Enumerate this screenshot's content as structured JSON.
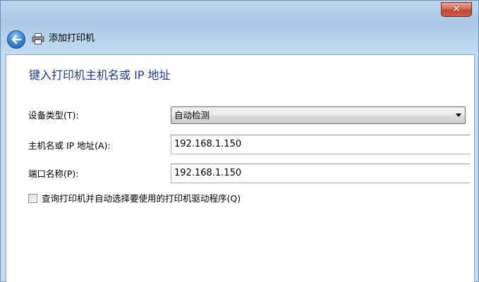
{
  "window": {
    "title": "添加打印机",
    "close_label": "✕"
  },
  "main": {
    "heading": "键入打印机主机名或 IP 地址",
    "device_type": {
      "label": "设备类型(T):",
      "value": "自动检测"
    },
    "hostname": {
      "label": "主机名或 IP 地址(A):",
      "value": "192.168.1.150"
    },
    "port_name": {
      "label": "端口名称(P):",
      "value": "192.168.1.150"
    },
    "query_checkbox": {
      "label": "查询打印机并自动选择要使用的打印机驱动程序(Q)",
      "checked": false
    }
  },
  "icons": {
    "back": "back-arrow-icon",
    "printer": "printer-icon",
    "close": "close-icon"
  },
  "colors": {
    "heading": "#1e3a8a",
    "close_button": "#c24632",
    "frame": "#c3dbf1"
  }
}
